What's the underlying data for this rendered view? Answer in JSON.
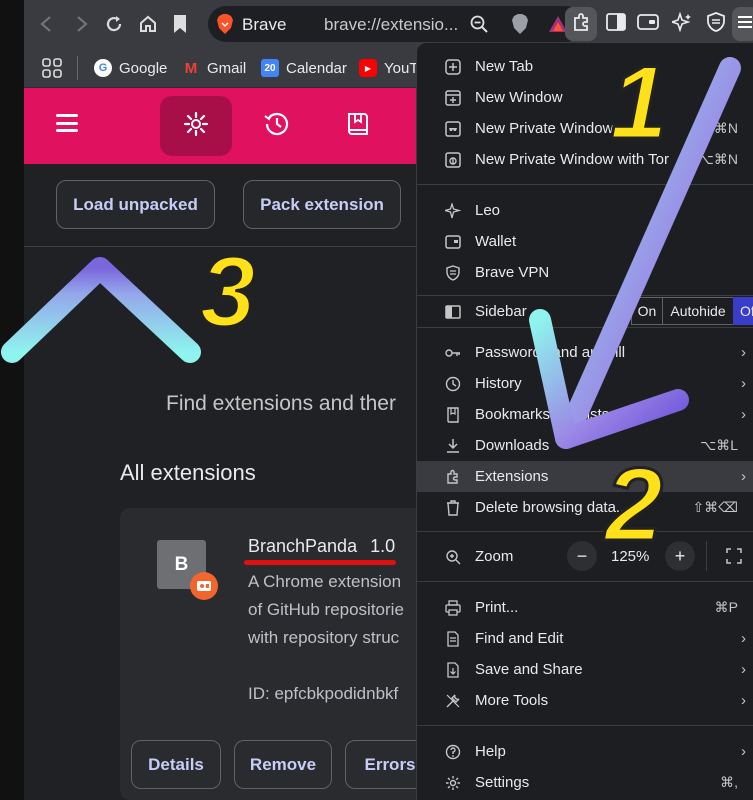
{
  "toolbar": {
    "tab_title": "Brave",
    "url": "brave://extensio..."
  },
  "bookmarks": [
    {
      "label": "Google"
    },
    {
      "label": "Gmail"
    },
    {
      "label": "Calendar"
    },
    {
      "label": "YouTu"
    }
  ],
  "actions": {
    "load_unpacked": "Load unpacked",
    "pack_extension": "Pack extension"
  },
  "main": {
    "find_text": "Find extensions and ther",
    "all_extensions": "All extensions"
  },
  "extension_card": {
    "avatar_letter": "B",
    "name": "BranchPanda",
    "version": "1.0",
    "desc_lines": [
      "A Chrome extension",
      "of GitHub repositorie",
      "with repository struc"
    ],
    "id": "ID: epfcbkpodidnbkf",
    "details": "Details",
    "remove": "Remove",
    "errors": "Errors"
  },
  "menu": {
    "new_tab": "New Tab",
    "new_window": "New Window",
    "new_private_window": "New Private Window",
    "new_private_window_sc": "⇧⌘N",
    "new_private_tor": "New Private Window with Tor",
    "new_private_tor_sc": "⌥⌘N",
    "leo": "Leo",
    "wallet": "Wallet",
    "brave_vpn": "Brave VPN",
    "sidebar": "Sidebar",
    "sidebar_on": "On",
    "sidebar_autohide": "Autohide",
    "sidebar_off": "Off",
    "passwords": "Passwords and autofill",
    "history": "History",
    "bookmarks": "Bookmarks and lists",
    "downloads": "Downloads",
    "downloads_sc": "⌥⌘L",
    "extensions": "Extensions",
    "delete_browsing": "Delete browsing data...",
    "delete_browsing_sc": "⇧⌘⌫",
    "zoom": "Zoom",
    "zoom_minus": "−",
    "zoom_value": "125%",
    "zoom_plus": "+",
    "print": "Print...",
    "print_sc": "⌘P",
    "find_edit": "Find and Edit",
    "save_share": "Save and Share",
    "more_tools": "More Tools",
    "help": "Help",
    "settings": "Settings",
    "settings_sc": "⌘,"
  },
  "annotations": {
    "num1": "1",
    "num2": "2",
    "num3": "3"
  }
}
